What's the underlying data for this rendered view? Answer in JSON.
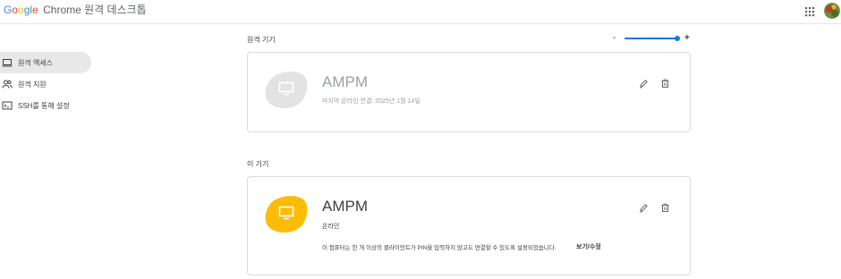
{
  "header": {
    "logo_letters": [
      "G",
      "o",
      "o",
      "g",
      "l",
      "e"
    ],
    "app_name": "Chrome 원격 데스크톱",
    "apps_icon": "grid-icon",
    "avatar_icon": "user-avatar"
  },
  "sidebar": {
    "items": [
      {
        "label": "원격 액세스",
        "icon": "laptop-icon",
        "active": true
      },
      {
        "label": "원격 지원",
        "icon": "people-icon",
        "active": false
      },
      {
        "label": "SSH를 통해 설정",
        "icon": "terminal-icon",
        "active": false
      }
    ]
  },
  "remote_devices": {
    "label": "원격 기기",
    "zoom": {
      "minus": "-",
      "plus": "+",
      "level": 1.0
    },
    "host": {
      "name": "AMPM",
      "status": "마지막 온라인 연결: 2025년 1월 14일",
      "icon": "monitor-icon"
    }
  },
  "this_device": {
    "label": "이 기기",
    "host": {
      "name": "AMPM",
      "status": "온라인",
      "pin_note": "이 컴퓨터는 한 개 이상의 클라이언트가 PIN을 입력하지 않고도 연결할 수 있도록 설정되었습니다.",
      "pin_link": "보기/수정",
      "icon": "monitor-icon"
    }
  },
  "colors": {
    "offline_blob": "#e3e3e3",
    "online_blob": "#fbbc04",
    "accent": "#1a73e8",
    "google_blue": "#4285f4",
    "google_red": "#ea4335",
    "google_yellow": "#fbbc05",
    "google_green": "#34a853"
  }
}
